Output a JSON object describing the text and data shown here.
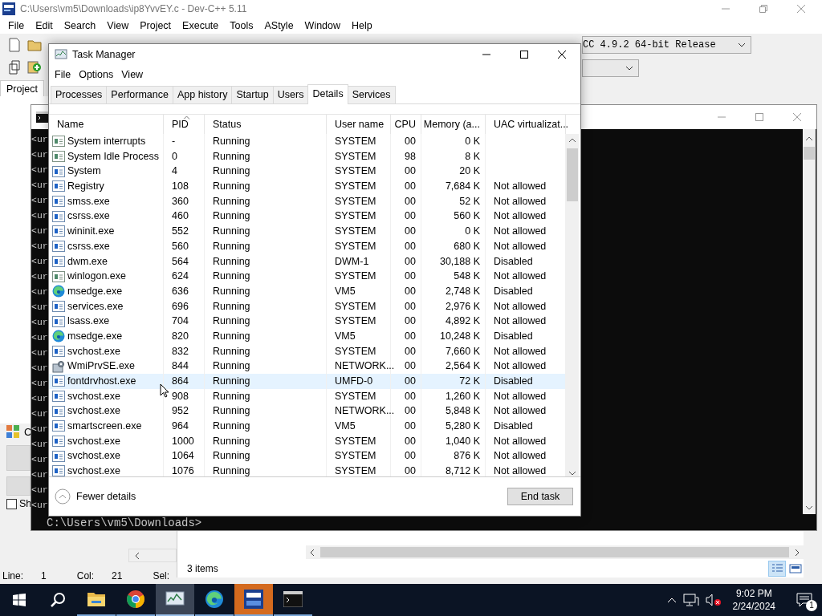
{
  "ide": {
    "title": "C:\\Users\\vm5\\Downloads\\ip8YvvEY.c - Dev-C++ 5.11",
    "menu": [
      "File",
      "Edit",
      "Search",
      "View",
      "Project",
      "Execute",
      "Tools",
      "AStyle",
      "Window",
      "Help"
    ],
    "compiler": "CC 4.9.2 64-bit Release",
    "project_tab": "Project",
    "panel_tab": "C",
    "checkbox": {
      "label": "Sh",
      "checked": false
    },
    "status": [
      {
        "label": "Line:",
        "value": "1"
      },
      {
        "label": "Col:",
        "value": "21"
      },
      {
        "label": "Sel:"
      }
    ]
  },
  "console": {
    "lines": [
      "<ur",
      "<ur",
      "<ur",
      "<ur",
      "<ur",
      "<ur",
      "<ur",
      "<ur",
      "<ur",
      "<ur",
      "<ur",
      "<ur",
      "<ur",
      "<ur",
      "<ur",
      "<ur",
      "<ur",
      "<ur",
      "<ur",
      "<ur",
      "<ur",
      "<ur",
      "<ur",
      "<ur",
      "<ur"
    ],
    "prompt": "C:\\Users\\vm5\\Downloads>"
  },
  "explorer": {
    "status": "3 items"
  },
  "task_manager": {
    "title": "Task Manager",
    "menu": [
      "File",
      "Options",
      "View"
    ],
    "tabs": [
      {
        "label": "Processes",
        "selected": false
      },
      {
        "label": "Performance",
        "selected": false
      },
      {
        "label": "App history",
        "selected": false
      },
      {
        "label": "Startup",
        "selected": false
      },
      {
        "label": "Users",
        "selected": false
      },
      {
        "label": "Details",
        "selected": true
      },
      {
        "label": "Services",
        "selected": false
      }
    ],
    "columns": [
      "Name",
      "PID",
      "Status",
      "User name",
      "CPU",
      "Memory (a...",
      "UAC virtualizat..."
    ],
    "rows": [
      {
        "kind": "system",
        "name": "System interrupts",
        "pid": "-",
        "status": "Running",
        "user": "SYSTEM",
        "cpu": "00",
        "memory": "0 K",
        "selected": false
      },
      {
        "kind": "system",
        "name": "System Idle Process",
        "pid": "0",
        "status": "Running",
        "user": "SYSTEM",
        "cpu": "98",
        "memory": "8 K",
        "selected": false
      },
      {
        "kind": "app",
        "name": "System",
        "pid": "4",
        "status": "Running",
        "user": "SYSTEM",
        "cpu": "00",
        "memory": "20 K",
        "selected": false
      },
      {
        "kind": "app",
        "name": "Registry",
        "pid": "108",
        "status": "Running",
        "user": "SYSTEM",
        "cpu": "00",
        "memory": "7,684 K",
        "uac": "Not allowed",
        "selected": false
      },
      {
        "kind": "app",
        "name": "smss.exe",
        "pid": "360",
        "status": "Running",
        "user": "SYSTEM",
        "cpu": "00",
        "memory": "52 K",
        "uac": "Not allowed",
        "selected": false
      },
      {
        "kind": "app",
        "name": "csrss.exe",
        "pid": "460",
        "status": "Running",
        "user": "SYSTEM",
        "cpu": "00",
        "memory": "560 K",
        "uac": "Not allowed",
        "selected": false
      },
      {
        "kind": "app",
        "name": "wininit.exe",
        "pid": "552",
        "status": "Running",
        "user": "SYSTEM",
        "cpu": "00",
        "memory": "0 K",
        "uac": "Not allowed",
        "selected": false
      },
      {
        "kind": "app",
        "name": "csrss.exe",
        "pid": "560",
        "status": "Running",
        "user": "SYSTEM",
        "cpu": "00",
        "memory": "680 K",
        "uac": "Not allowed",
        "selected": false
      },
      {
        "kind": "app",
        "name": "dwm.exe",
        "pid": "564",
        "status": "Running",
        "user": "DWM-1",
        "cpu": "00",
        "memory": "30,188 K",
        "uac": "Disabled",
        "selected": false
      },
      {
        "kind": "system",
        "name": "winlogon.exe",
        "pid": "624",
        "status": "Running",
        "user": "SYSTEM",
        "cpu": "00",
        "memory": "548 K",
        "uac": "Not allowed",
        "selected": false
      },
      {
        "kind": "edge",
        "name": "msedge.exe",
        "pid": "636",
        "status": "Running",
        "user": "VM5",
        "cpu": "00",
        "memory": "2,748 K",
        "uac": "Disabled",
        "selected": false
      },
      {
        "kind": "app",
        "name": "services.exe",
        "pid": "696",
        "status": "Running",
        "user": "SYSTEM",
        "cpu": "00",
        "memory": "2,976 K",
        "uac": "Not allowed",
        "selected": false
      },
      {
        "kind": "app",
        "name": "lsass.exe",
        "pid": "704",
        "status": "Running",
        "user": "SYSTEM",
        "cpu": "00",
        "memory": "4,892 K",
        "uac": "Not allowed",
        "selected": false
      },
      {
        "kind": "edge",
        "name": "msedge.exe",
        "pid": "820",
        "status": "Running",
        "user": "VM5",
        "cpu": "00",
        "memory": "10,248 K",
        "uac": "Disabled",
        "selected": false
      },
      {
        "kind": "app",
        "name": "svchost.exe",
        "pid": "832",
        "status": "Running",
        "user": "SYSTEM",
        "cpu": "00",
        "memory": "7,660 K",
        "uac": "Not allowed",
        "selected": false
      },
      {
        "kind": "wmi",
        "name": "WmiPrvSE.exe",
        "pid": "844",
        "status": "Running",
        "user": "NETWORK...",
        "cpu": "00",
        "memory": "2,564 K",
        "uac": "Not allowed",
        "selected": false
      },
      {
        "kind": "app",
        "name": "fontdrvhost.exe",
        "pid": "864",
        "status": "Running",
        "user": "UMFD-0",
        "cpu": "00",
        "memory": "72 K",
        "uac": "Disabled",
        "selected": true
      },
      {
        "kind": "app",
        "name": "svchost.exe",
        "pid": "908",
        "status": "Running",
        "user": "SYSTEM",
        "cpu": "00",
        "memory": "1,260 K",
        "uac": "Not allowed",
        "selected": false
      },
      {
        "kind": "app",
        "name": "svchost.exe",
        "pid": "952",
        "status": "Running",
        "user": "NETWORK...",
        "cpu": "00",
        "memory": "5,848 K",
        "uac": "Not allowed",
        "selected": false
      },
      {
        "kind": "app",
        "name": "smartscreen.exe",
        "pid": "964",
        "status": "Running",
        "user": "VM5",
        "cpu": "00",
        "memory": "5,280 K",
        "uac": "Disabled",
        "selected": false
      },
      {
        "kind": "app",
        "name": "svchost.exe",
        "pid": "1000",
        "status": "Running",
        "user": "SYSTEM",
        "cpu": "00",
        "memory": "1,040 K",
        "uac": "Not allowed",
        "selected": false
      },
      {
        "kind": "app",
        "name": "svchost.exe",
        "pid": "1064",
        "status": "Running",
        "user": "SYSTEM",
        "cpu": "00",
        "memory": "876 K",
        "uac": "Not allowed",
        "selected": false
      },
      {
        "kind": "app",
        "name": "svchost.exe",
        "pid": "1076",
        "status": "Running",
        "user": "SYSTEM",
        "cpu": "00",
        "memory": "8,712 K",
        "uac": "Not allowed",
        "selected": false
      }
    ],
    "fewer_details": "Fewer details",
    "end_task": "End task"
  },
  "taskbar": {
    "apps": [
      {
        "kind": "explorer",
        "focused": false,
        "flashing": false
      },
      {
        "kind": "chrome",
        "focused": false,
        "flashing": false
      },
      {
        "kind": "taskmgr",
        "focused": true,
        "flashing": false
      },
      {
        "kind": "edge",
        "focused": false,
        "flashing": false
      },
      {
        "kind": "devcpp",
        "focused": false,
        "flashing": true
      },
      {
        "kind": "cmd",
        "focused": false,
        "flashing": false
      }
    ],
    "time": "9:02 PM",
    "date": "2/24/2024",
    "notifications": "1"
  }
}
